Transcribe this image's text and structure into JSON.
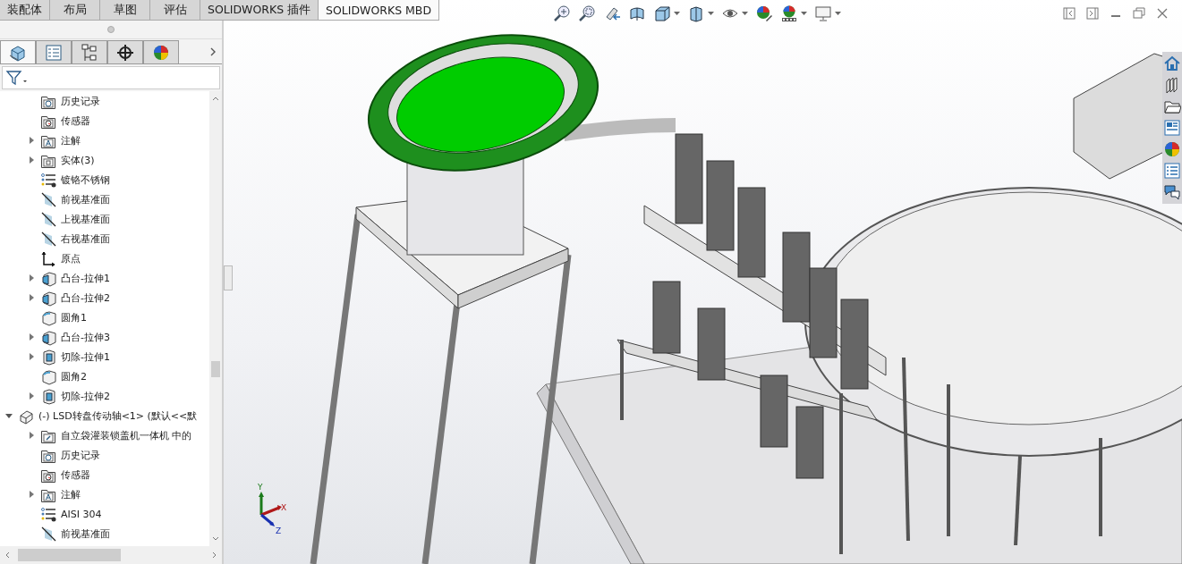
{
  "ribbon_tabs": [
    {
      "label": "装配体",
      "selected": false
    },
    {
      "label": "布局",
      "selected": false
    },
    {
      "label": "草图",
      "selected": false
    },
    {
      "label": "评估",
      "selected": false
    },
    {
      "label": "SOLIDWORKS 插件",
      "selected": false
    },
    {
      "label": "SOLIDWORKS MBD",
      "selected": true
    }
  ],
  "panel_tabs": [
    {
      "selected": true
    },
    {
      "selected": false
    },
    {
      "selected": false
    },
    {
      "selected": false
    },
    {
      "selected": false
    }
  ],
  "tree": {
    "continued_children": [
      {
        "label": "历史记录",
        "kind": "history"
      },
      {
        "label": "传感器",
        "kind": "sensors"
      },
      {
        "label": "注解",
        "kind": "annotations",
        "expanded": false
      },
      {
        "label": "实体(3)",
        "kind": "bodies",
        "expanded": false
      },
      {
        "label": "镀铬不锈钢",
        "kind": "material"
      },
      {
        "label": "前视基准面",
        "kind": "plane"
      },
      {
        "label": "上视基准面",
        "kind": "plane"
      },
      {
        "label": "右视基准面",
        "kind": "plane"
      },
      {
        "label": "原点",
        "kind": "origin"
      },
      {
        "label": "凸台-拉伸1",
        "kind": "boss",
        "expanded": false
      },
      {
        "label": "凸台-拉伸2",
        "kind": "boss",
        "expanded": false
      },
      {
        "label": "圆角1",
        "kind": "fillet"
      },
      {
        "label": "凸台-拉伸3",
        "kind": "boss",
        "expanded": false
      },
      {
        "label": "切除-拉伸1",
        "kind": "cut",
        "expanded": false
      },
      {
        "label": "圆角2",
        "kind": "fillet"
      },
      {
        "label": "切除-拉伸2",
        "kind": "cut",
        "expanded": false
      }
    ],
    "items": [
      {
        "label": "(-) LSD转盘传动轴<1> (默认<<默",
        "kind": "component",
        "expanded": true,
        "children": [
          {
            "label": "自立袋灌装锁盖机一体机 中的",
            "kind": "reference",
            "expanded": false
          },
          {
            "label": "历史记录",
            "kind": "history"
          },
          {
            "label": "传感器",
            "kind": "sensors"
          },
          {
            "label": "注解",
            "kind": "annotations",
            "expanded": false
          },
          {
            "label": "AISI 304",
            "kind": "material"
          },
          {
            "label": "前视基准面",
            "kind": "plane"
          }
        ]
      }
    ]
  },
  "triad": {
    "x": "X",
    "y": "Y",
    "z": "Z"
  }
}
